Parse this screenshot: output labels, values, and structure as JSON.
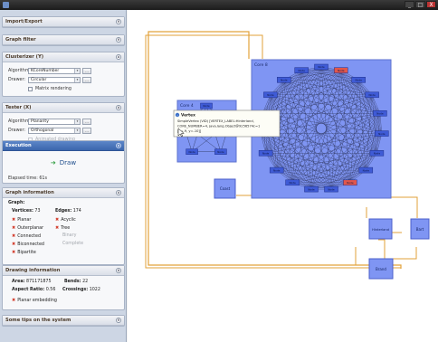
{
  "window": {
    "title": "",
    "buttons": {
      "minimize": "_",
      "maximize": "□",
      "close": "X"
    }
  },
  "sidebar": {
    "import_export": {
      "title": "Import/Export"
    },
    "graph_filter": {
      "title": "Graph filter"
    },
    "clusterizer": {
      "title": "Clusterizer (Y)",
      "algorithm_label": "Algorithm:",
      "algorithm_value": "KCoreNumber",
      "drawer_label": "Drawer:",
      "drawer_value": "Circular",
      "matrix_label": "Matrix rendering",
      "button_label": "..."
    },
    "tester": {
      "title": "Tester (X)",
      "algorithm_label": "Algorithm:",
      "algorithm_value": "Planarity",
      "drawer_label": "Drawer:",
      "drawer_value": "Orthogonal",
      "animated_label": "Animated drawing",
      "button_label": "..."
    },
    "execution": {
      "title": "Execution",
      "draw_label": "Draw",
      "elapsed_label": "Elapsed time:",
      "elapsed_value": "61s"
    },
    "graph_info": {
      "title": "Graph information",
      "graph_label": "Graph:",
      "vertices_label": "Vertices:",
      "vertices_value": "73",
      "edges_label": "Edges:",
      "edges_value": "174",
      "props": [
        "Planar",
        "Outerplanar",
        "Connected",
        "Biconnected",
        "Bipartite"
      ],
      "props_right": [
        "Acyclic",
        "Tree",
        "Binary",
        "Complete"
      ]
    },
    "drawing_info": {
      "title": "Drawing information",
      "area_label": "Area:",
      "area_value": "871171875",
      "bends_label": "Bends:",
      "bends_value": "22",
      "aspect_label": "Aspect Ratio:",
      "aspect_value": "0.56",
      "crossings_label": "Crossings:",
      "crossings_value": "1022",
      "planar_label": "Planar embedding"
    },
    "tips": {
      "title": "Some tips on the system"
    }
  },
  "canvas": {
    "core8_label": "Core 8",
    "core4_label": "Core 4",
    "core8_nodes": [
      "Node",
      "Node",
      "Node",
      "Node",
      "Node",
      "Node",
      "Node",
      "Node",
      "Node",
      "Node",
      "Node",
      "Node",
      "Node",
      "Node",
      "Node",
      "Node",
      "Node",
      "Node",
      "Node"
    ],
    "core4_nodes": [
      "Node",
      "Node",
      "Node",
      "Node",
      "Node"
    ],
    "outer_nodes": [
      "Coast",
      "Hinterland",
      "Bart",
      "Brand"
    ],
    "tooltip": {
      "title": "Vertex",
      "line1": "SimpleVertex (VID) [VERTEX_LABEL:Hinterland,",
      "line2": "CORE_NUMBER=4, java.lang.Object@9256574c=1",
      "line3": "[x=-9, y=-10]]"
    }
  },
  "colors": {
    "sidebar_bg": "#cdd6e4",
    "cluster_fill": "#7f95f3",
    "node_fill": "#3f5bd6",
    "node_highlight": "#e0574d",
    "orange_edge": "#e2a23a",
    "execution_header": "#4a74b9"
  }
}
